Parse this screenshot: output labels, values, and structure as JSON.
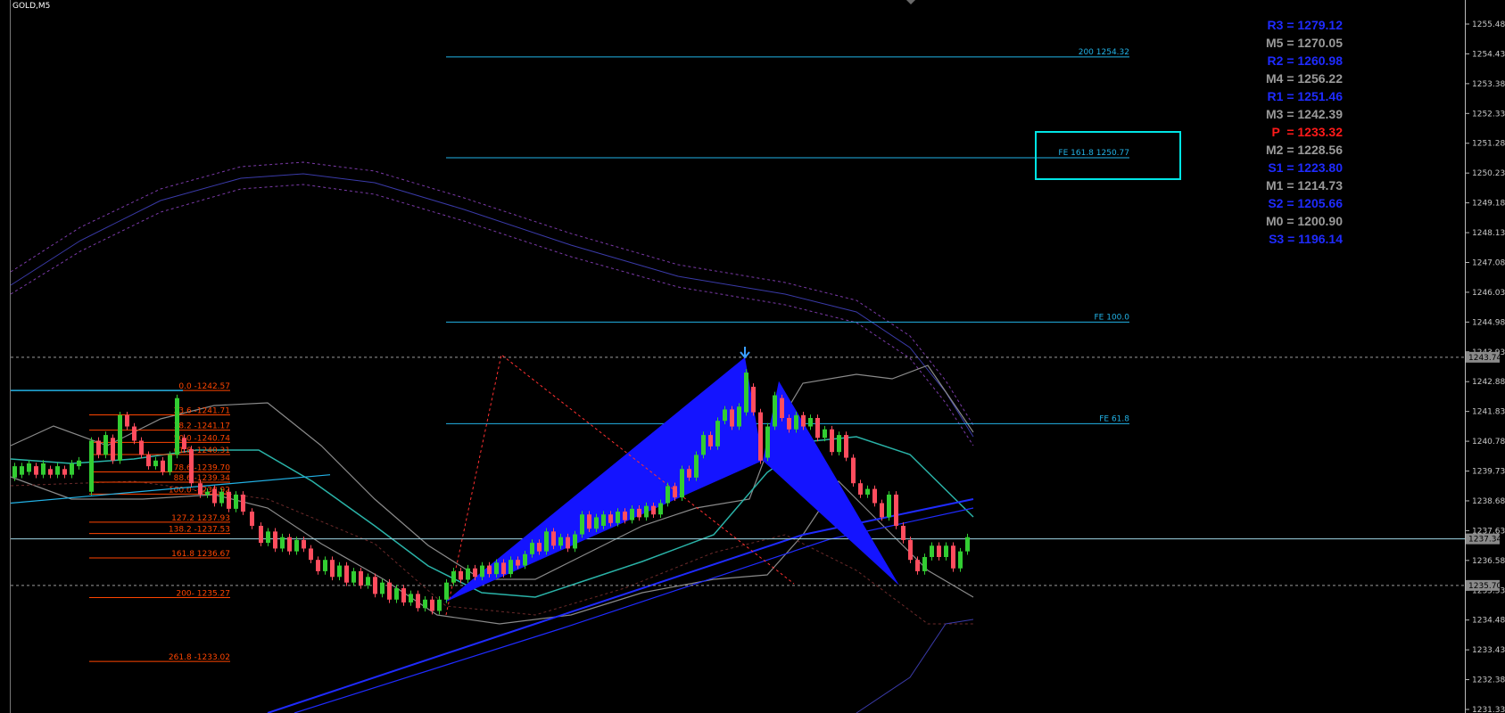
{
  "window": {
    "symbol_title": "GOLD,M5"
  },
  "colors": {
    "background": "#000000",
    "bull_candle": "#32cd32",
    "bear_candle": "#ff4d5e",
    "pattern_fill": "#1414ff",
    "level_line": "#22b2e6",
    "fib_retrace": "#ff4500",
    "highlight_box": "#00e5e5",
    "pivot_blue": "#1f2bff",
    "pivot_gray": "#9a9a9a",
    "pivot_red": "#ff1a1a"
  },
  "pivots": [
    {
      "label": "R3 = 1279.12",
      "color": "blue"
    },
    {
      "label": "M5 = 1270.05",
      "color": "gray"
    },
    {
      "label": "R2 = 1260.98",
      "color": "blue"
    },
    {
      "label": "M4 = 1256.22",
      "color": "gray"
    },
    {
      "label": "R1 = 1251.46",
      "color": "blue"
    },
    {
      "label": "M3 = 1242.39",
      "color": "gray"
    },
    {
      "label": "P  = 1233.32",
      "color": "red"
    },
    {
      "label": "M2 = 1228.56",
      "color": "gray"
    },
    {
      "label": "S1 = 1223.80",
      "color": "blue"
    },
    {
      "label": "M1 = 1214.73",
      "color": "gray"
    },
    {
      "label": "S2 = 1205.66",
      "color": "blue"
    },
    {
      "label": "M0 = 1200.90",
      "color": "gray"
    },
    {
      "label": "S3 = 1196.14",
      "color": "blue"
    }
  ],
  "chart_data": {
    "type": "candlestick",
    "y_axis": {
      "ticks": [
        "1255.48",
        "1254.43",
        "1253.38",
        "1252.33",
        "1251.28",
        "1250.23",
        "1249.18",
        "1248.13",
        "1247.08",
        "1246.03",
        "1244.98",
        "1243.93",
        "1242.88",
        "1241.83",
        "1240.78",
        "1239.73",
        "1238.68",
        "1237.63",
        "1236.58",
        "1235.53",
        "1234.48",
        "1233.43",
        "1232.38",
        "1231.33"
      ],
      "range": [
        1231.33,
        1255.48
      ],
      "price_tags": [
        "1243.74",
        "1237.34",
        "1235.70"
      ]
    },
    "fib_extension": [
      {
        "label": "200 1254.32",
        "price": 1254.32
      },
      {
        "label": "FE 161.8 1250.77",
        "price": 1250.77
      },
      {
        "label": "FE 100.0",
        "price": 1244.98
      },
      {
        "label": "FE 61.8",
        "price": 1241.4
      }
    ],
    "fib_retracement": [
      {
        "label": "0.0 -1242.57",
        "price": 1242.57
      },
      {
        "label": "23.6 -1241.71",
        "price": 1241.71
      },
      {
        "label": "38.2 -1241.17",
        "price": 1241.17
      },
      {
        "label": "50.0 -1240.74",
        "price": 1240.74
      },
      {
        "label": "61.8 -1240.31",
        "price": 1240.31
      },
      {
        "label": "78.6 -1239.70",
        "price": 1239.7
      },
      {
        "label": "88.6 -1239.34",
        "price": 1239.34
      },
      {
        "label": "100.0 -1238.92",
        "price": 1238.92
      },
      {
        "label": "127.2 1237.93",
        "price": 1237.93
      },
      {
        "label": "138.2 -1237.53",
        "price": 1237.53
      },
      {
        "label": "161.8 1236.67",
        "price": 1236.67
      },
      {
        "label": "200- 1235.27",
        "price": 1235.27
      },
      {
        "label": "261.8 -1233.02",
        "price": 1233.02
      }
    ],
    "horizontal_lines": [
      1243.74,
      1237.34,
      1235.7
    ],
    "pattern_points": {
      "X": 1235.1,
      "A": 1243.74,
      "B": 1240.1,
      "C": 1242.9,
      "D": 1235.7
    }
  }
}
